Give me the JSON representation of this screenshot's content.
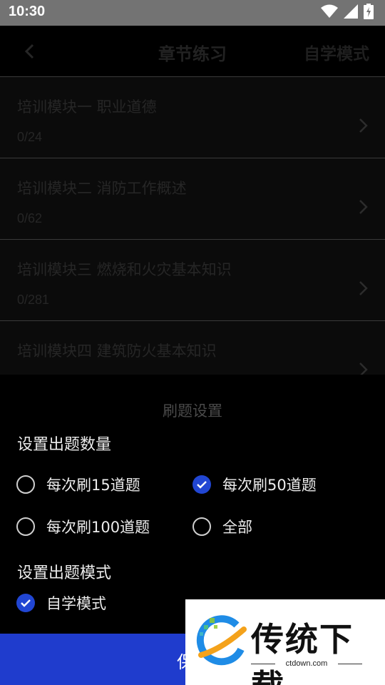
{
  "status_bar": {
    "time": "10:30",
    "icons": [
      "wifi-icon",
      "signal-icon",
      "battery-charging-icon"
    ]
  },
  "app_bar": {
    "back_icon": "chevron-left-icon",
    "title": "章节练习",
    "mode_link": "自学模式"
  },
  "chapters": [
    {
      "title": "培训模块一 职业道德",
      "progress": "0/24"
    },
    {
      "title": "培训模块二 消防工作概述",
      "progress": "0/62"
    },
    {
      "title": "培训模块三 燃烧和火灾基本知识",
      "progress": "0/281"
    },
    {
      "title": "培训模块四 建筑防火基本知识",
      "progress": ""
    }
  ],
  "sheet": {
    "title": "刷题设置",
    "count_section": {
      "label": "设置出题数量",
      "options": [
        {
          "label": "每次刷15道题",
          "selected": false
        },
        {
          "label": "每次刷50道题",
          "selected": true
        },
        {
          "label": "每次刷100道题",
          "selected": false
        },
        {
          "label": "全部",
          "selected": false
        }
      ]
    },
    "mode_section": {
      "label": "设置出题模式",
      "options": [
        {
          "label": "自学模式",
          "selected": true
        }
      ]
    },
    "save_label": "保"
  },
  "watermark": {
    "brand": "传统下载",
    "url": "ctdown.com"
  },
  "colors": {
    "accent": "#2146d3",
    "save_bar": "#1f3ccd",
    "background": "#000000"
  }
}
